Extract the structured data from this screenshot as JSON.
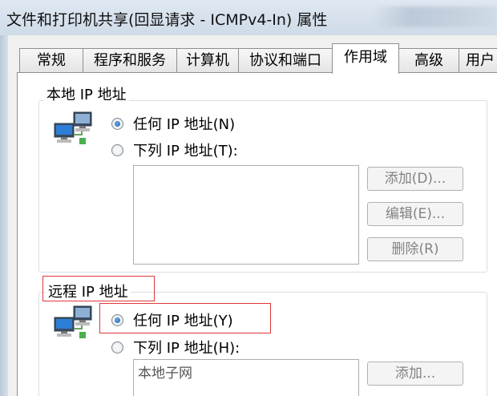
{
  "window": {
    "title": "文件和打印机共享(回显请求 - ICMPv4-In) 属性"
  },
  "tabs": [
    {
      "label": "常规",
      "active": false
    },
    {
      "label": "程序和服务",
      "active": false
    },
    {
      "label": "计算机",
      "active": false
    },
    {
      "label": "协议和端口",
      "active": false
    },
    {
      "label": "作用域",
      "active": true
    },
    {
      "label": "高级",
      "active": false
    },
    {
      "label": "用户",
      "active": false
    }
  ],
  "local_ip": {
    "group_label": "本地 IP 地址",
    "any_label": "任何 IP 地址(N)",
    "any_checked": true,
    "list_label": "下列 IP 地址(T):",
    "list_items": [],
    "add_label": "添加(D)...",
    "edit_label": "编辑(E)...",
    "delete_label": "删除(R)"
  },
  "remote_ip": {
    "group_label": "远程 IP 地址",
    "any_label": "任何 IP 地址(Y)",
    "any_checked": true,
    "list_label": "下列 IP 地址(H):",
    "list_items": [
      "本地子网"
    ],
    "add_label": "添加..."
  },
  "colors": {
    "highlight": "#e0383a",
    "tab_border": "#8e8f8f",
    "disabled_text": "#838383"
  },
  "icons": {
    "local_network": "network-computers-icon",
    "remote_network": "network-computers-icon"
  }
}
